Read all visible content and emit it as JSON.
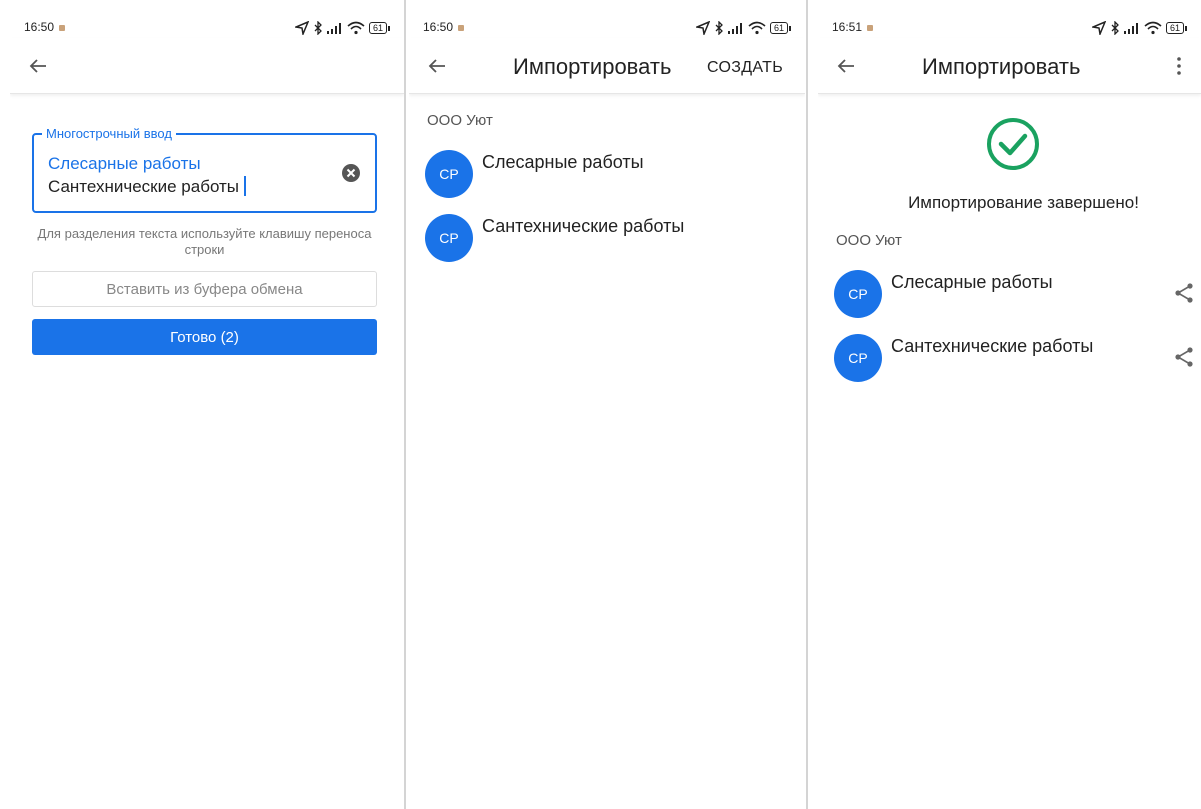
{
  "colors": {
    "accent": "#1a73e8",
    "success": "#1aa260",
    "avatar": "#1a73e8"
  },
  "screen1": {
    "status": {
      "time": "16:50",
      "battery": "61"
    },
    "field": {
      "legend": "Многострочный ввод",
      "lines": [
        "Слесарные работы",
        "Сантехнические работы"
      ]
    },
    "hint": "Для разделения текста используйте клавишу переноса строки",
    "paste_button": "Вставить из буфера обмена",
    "done_button": "Готово (2)"
  },
  "screen2": {
    "status": {
      "time": "16:50",
      "battery": "61"
    },
    "title": "Импортировать",
    "action": "СОЗДАТЬ",
    "section": "ООО Уют",
    "items": [
      {
        "avatar": "СР",
        "label": "Слесарные работы"
      },
      {
        "avatar": "СР",
        "label": "Сантехнические работы"
      }
    ]
  },
  "screen3": {
    "status": {
      "time": "16:51",
      "battery": "61"
    },
    "title": "Импортировать",
    "done_message": "Импортирование завершено!",
    "section": "ООО Уют",
    "items": [
      {
        "avatar": "СР",
        "label": "Слесарные работы"
      },
      {
        "avatar": "СР",
        "label": "Сантехнические работы"
      }
    ]
  }
}
